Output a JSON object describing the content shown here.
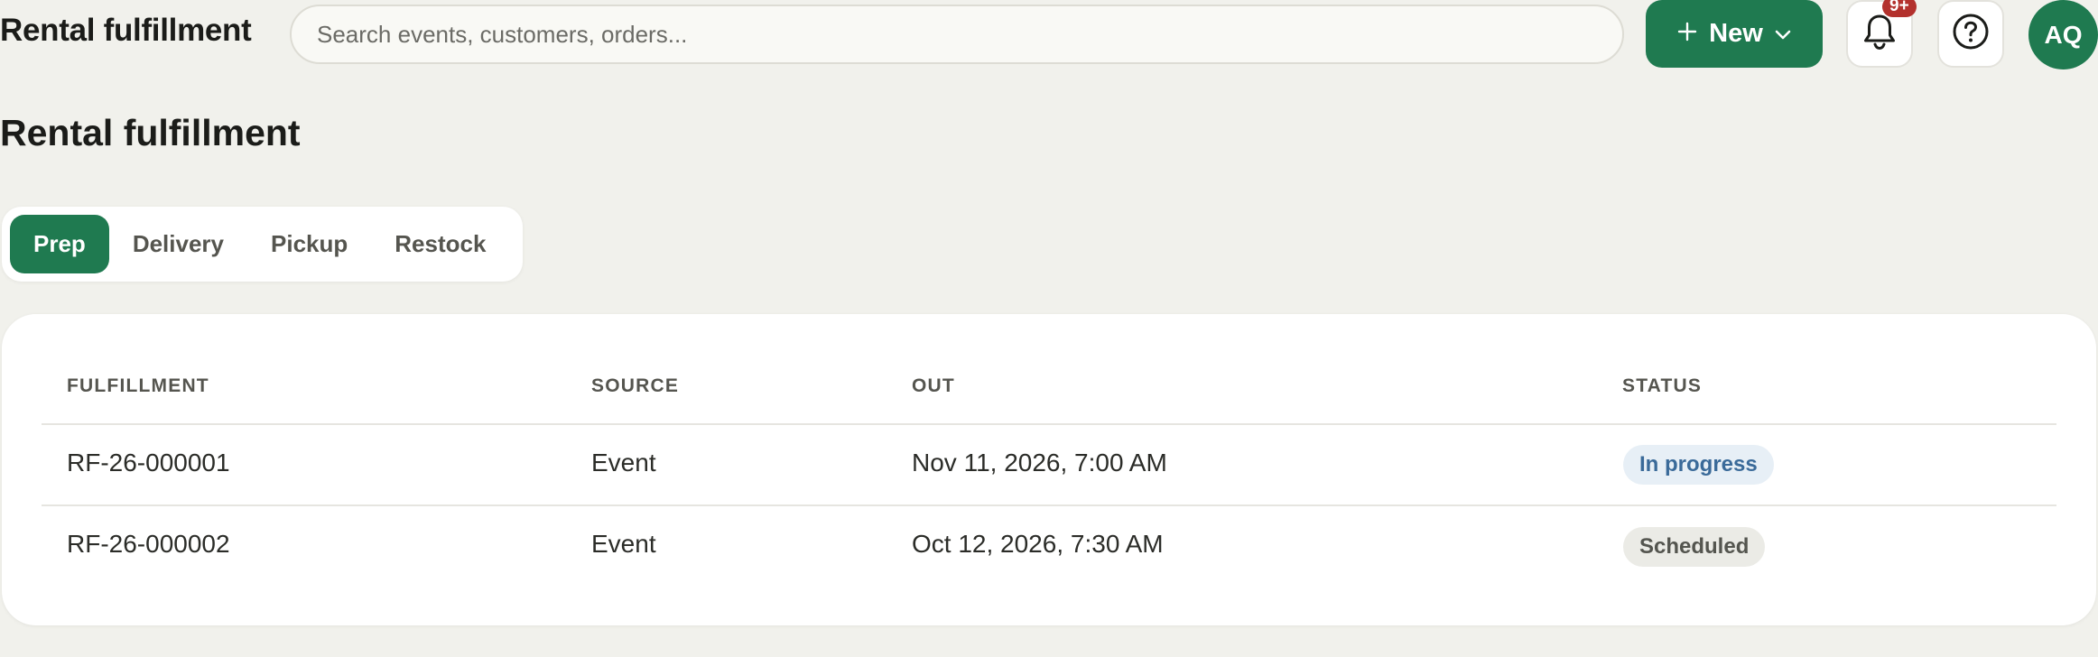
{
  "header": {
    "app_title": "Rental fulfillment",
    "search_placeholder": "Search events, customers, orders...",
    "new_label": "New",
    "notification_badge": "9+",
    "avatar_initials": "AQ"
  },
  "page": {
    "title": "Rental fulfillment"
  },
  "tabs": [
    {
      "label": "Prep",
      "active": true
    },
    {
      "label": "Delivery",
      "active": false
    },
    {
      "label": "Pickup",
      "active": false
    },
    {
      "label": "Restock",
      "active": false
    }
  ],
  "table": {
    "columns": [
      "FULFILLMENT",
      "SOURCE",
      "OUT",
      "STATUS"
    ],
    "rows": [
      {
        "id": "RF-26-000001",
        "source": "Event",
        "out": "Nov 11, 2026, 7:00 AM",
        "status": "In progress"
      },
      {
        "id": "RF-26-000002",
        "source": "Event",
        "out": "Oct 12, 2026, 7:30 AM",
        "status": "Scheduled"
      }
    ]
  },
  "colors": {
    "brand": "#1f7a50",
    "background": "#f1f1ec",
    "badge": "#b3312d",
    "status_in_progress": "#3a6a99",
    "status_scheduled": "#54554f"
  },
  "icons": [
    "plus-icon",
    "chevron-down-icon",
    "bell-icon",
    "help-circle-icon"
  ]
}
